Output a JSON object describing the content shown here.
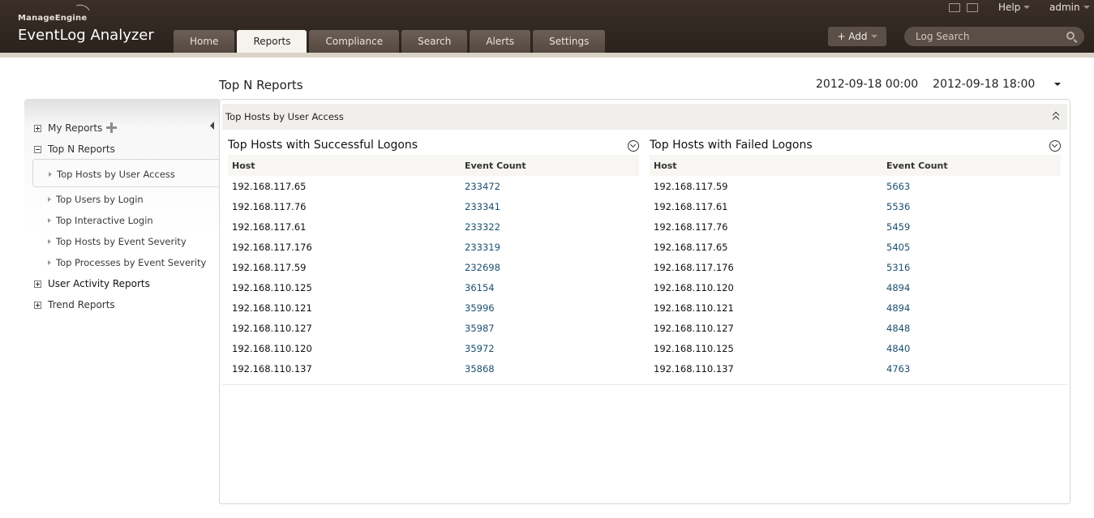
{
  "brand": {
    "company": "ManageEngine",
    "product": "EventLog Analyzer"
  },
  "tabs": [
    {
      "label": "Home"
    },
    {
      "label": "Reports"
    },
    {
      "label": "Compliance"
    },
    {
      "label": "Search"
    },
    {
      "label": "Alerts"
    },
    {
      "label": "Settings"
    }
  ],
  "header": {
    "help_label": "Help",
    "user_label": "admin",
    "add_label": "+ Add",
    "search_placeholder": "Log Search"
  },
  "page": {
    "title": "Top N Reports",
    "date_from": "2012-09-18 00:00",
    "date_to": "2012-09-18 18:00"
  },
  "sidebar": {
    "my_reports": "My Reports",
    "top_n": "Top N Reports",
    "sub_items": [
      {
        "label": "Top Hosts by User Access"
      },
      {
        "label": "Top Users by Login"
      },
      {
        "label": "Top Interactive Login"
      },
      {
        "label": "Top Hosts by Event Severity"
      },
      {
        "label": "Top Processes by Event Severity"
      }
    ],
    "user_activity": "User Activity Reports",
    "trend": "Trend Reports"
  },
  "panel": {
    "title": "Top Hosts by User Access"
  },
  "successful": {
    "title": "Top Hosts with Successful Logons",
    "col_host": "Host",
    "col_count": "Event Count",
    "rows": [
      {
        "host": "192.168.117.65",
        "count": "233472"
      },
      {
        "host": "192.168.117.76",
        "count": "233341"
      },
      {
        "host": "192.168.117.61",
        "count": "233322"
      },
      {
        "host": "192.168.117.176",
        "count": "233319"
      },
      {
        "host": "192.168.117.59",
        "count": "232698"
      },
      {
        "host": "192.168.110.125",
        "count": "36154"
      },
      {
        "host": "192.168.110.121",
        "count": "35996"
      },
      {
        "host": "192.168.110.127",
        "count": "35987"
      },
      {
        "host": "192.168.110.120",
        "count": "35972"
      },
      {
        "host": "192.168.110.137",
        "count": "35868"
      }
    ]
  },
  "failed": {
    "title": "Top Hosts with Failed Logons",
    "col_host": "Host",
    "col_count": "Event Count",
    "rows": [
      {
        "host": "192.168.117.59",
        "count": "5663"
      },
      {
        "host": "192.168.117.61",
        "count": "5536"
      },
      {
        "host": "192.168.117.76",
        "count": "5459"
      },
      {
        "host": "192.168.117.65",
        "count": "5405"
      },
      {
        "host": "192.168.117.176",
        "count": "5316"
      },
      {
        "host": "192.168.110.120",
        "count": "4894"
      },
      {
        "host": "192.168.110.121",
        "count": "4894"
      },
      {
        "host": "192.168.110.127",
        "count": "4848"
      },
      {
        "host": "192.168.110.125",
        "count": "4840"
      },
      {
        "host": "192.168.110.137",
        "count": "4763"
      }
    ]
  }
}
